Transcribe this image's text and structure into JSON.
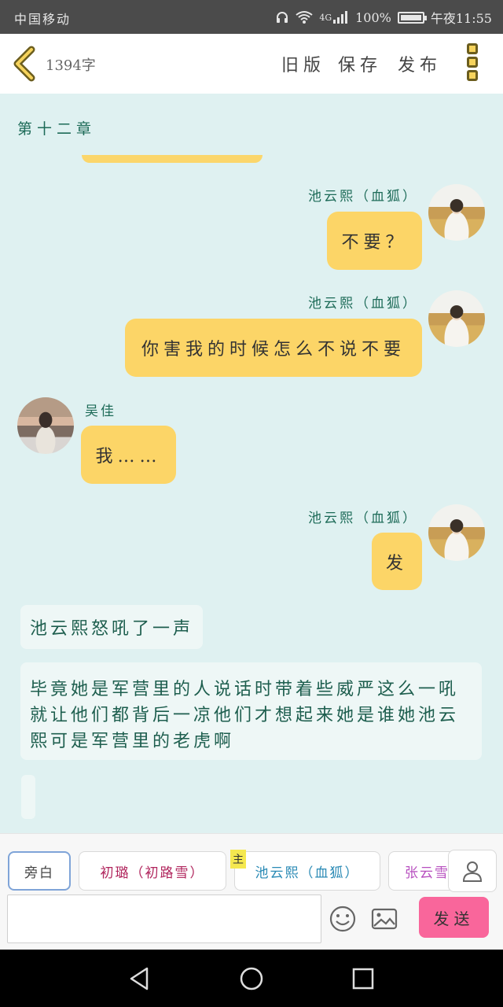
{
  "status_bar": {
    "carrier": "中国移动",
    "signal": "4G",
    "battery_text": "100%",
    "battery_level": 1.0,
    "time": "午夜11:55"
  },
  "header": {
    "word_count": "1394字",
    "old_version_label": "旧版",
    "save_label": "保存",
    "publish_label": "发布"
  },
  "chat": {
    "chapter_title": "第十二章",
    "messages": [
      {
        "speaker": "池云熙（血狐）",
        "text": "不要？"
      },
      {
        "speaker": "池云熙（血狐）",
        "text": "你害我的时候怎么不说不要"
      },
      {
        "speaker": "吴佳",
        "text": "我……"
      },
      {
        "speaker": "池云熙（血狐）",
        "text": "发"
      }
    ],
    "narrations": [
      "池云熙怒吼了一声",
      "毕竟她是军营里的人说话时带着些威严这么一吼就让他们都背后一凉他们才想起来她是谁她池云熙可是军营里的老虎啊"
    ]
  },
  "bottom": {
    "chips": [
      "旁白",
      "初璐（初路雪）",
      "池云熙（血狐）",
      "张云雪"
    ],
    "main_badge": "主",
    "input_value": "",
    "send_label": "发送"
  },
  "colors": {
    "chat_background": "#dff1f1",
    "bubble": "#fcd567",
    "accent_send": "#f9669b",
    "name_green": "#1d6b58"
  }
}
